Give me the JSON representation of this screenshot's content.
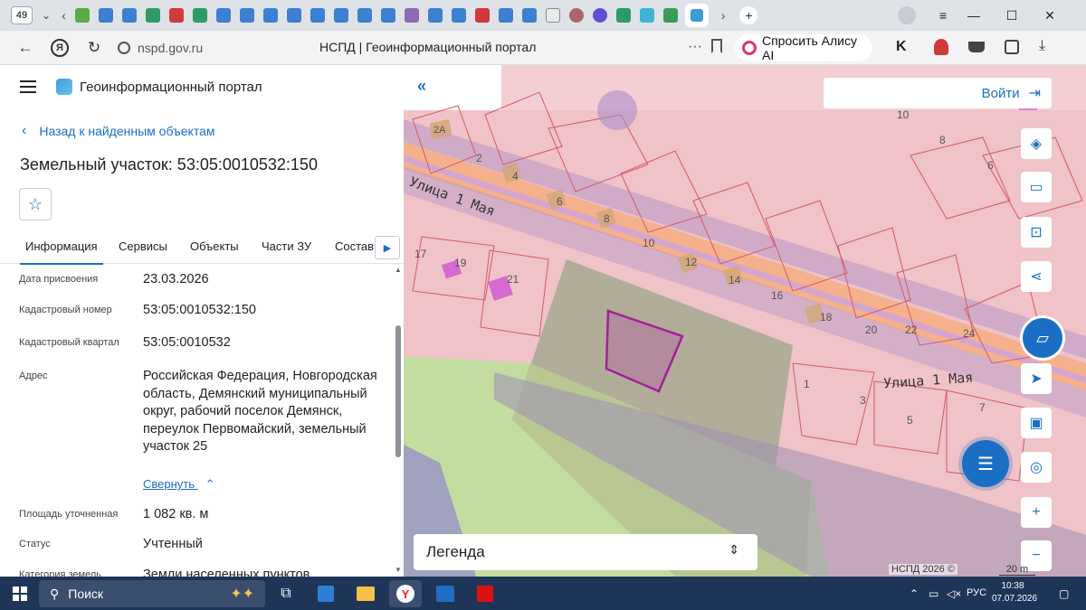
{
  "browser": {
    "tab_count": "49",
    "url": "nspd.gov.ru",
    "page_title": "НСПД | Геоинформационный портал",
    "alice_label": "Спросить Алису AI"
  },
  "sidebar": {
    "brand": "Геоинформационный портал",
    "back_link": "Назад к найденным объектам",
    "title": "Земельный участок: 53:05:0010532:150",
    "tabs": [
      "Информация",
      "Сервисы",
      "Объекты",
      "Части ЗУ",
      "Состав"
    ],
    "properties": [
      {
        "label": "Дата присвоения",
        "value": "23.03.2026"
      },
      {
        "label": "Кадастровый номер",
        "value": "53:05:0010532:150"
      },
      {
        "label": "Кадастровый квартал",
        "value": "53:05:0010532"
      },
      {
        "label": "Адрес",
        "value": "Российская Федерация, Новгородская область, Демянский муниципальный округ, рабочий поселок Демянск, переулок Первомайский, земельный участок 25"
      },
      {
        "label": "Площадь уточненная",
        "value": "1 082 кв. м"
      },
      {
        "label": "Статус",
        "value": "Учтенный"
      },
      {
        "label": "Категория земель",
        "value": "Земли населенных пунктов"
      }
    ],
    "collapse_label": "Свернуть"
  },
  "map": {
    "login_label": "Войти",
    "legend_label": "Легенда",
    "copyright": "НСПД 2026 ©",
    "scale": "20 m",
    "street_labels": [
      "Улица 1 Мая",
      "Улица 1 Мая"
    ],
    "parcel_numbers": [
      "2А",
      "2",
      "4",
      "6",
      "8",
      "10",
      "12",
      "14",
      "16",
      "18",
      "20",
      "22",
      "24",
      "17",
      "19",
      "21",
      "1",
      "3",
      "5",
      "7",
      "6",
      "8",
      "10"
    ]
  },
  "taskbar": {
    "search_label": "Поиск",
    "language": "РУС",
    "time": "10:38",
    "date": "07.07.2026"
  }
}
